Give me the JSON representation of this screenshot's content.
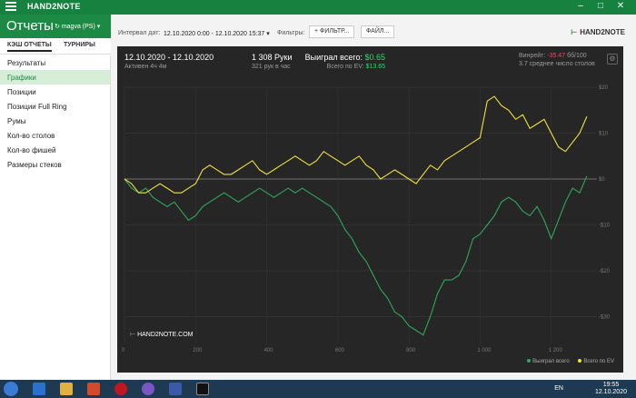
{
  "titlebar": {
    "app_name": "HAND2NOTE"
  },
  "header": {
    "title": "Отчеты",
    "profile": "magva (PS)"
  },
  "tabs": [
    {
      "label": "КЭШ ОТЧЕТЫ"
    },
    {
      "label": "ТУРНИРЫ"
    }
  ],
  "sidebar": {
    "items": [
      {
        "label": "Результаты"
      },
      {
        "label": "Графики"
      },
      {
        "label": "Позиции"
      },
      {
        "label": "Позиции Full Ring"
      },
      {
        "label": "Румы"
      },
      {
        "label": "Кол-во столов"
      },
      {
        "label": "Кол-во фишей"
      },
      {
        "label": "Размеры стеков"
      }
    ]
  },
  "toolbar": {
    "interval_label": "Интервал дат:",
    "interval_value": "12.10.2020 0:00 - 12.10.2020 15:37",
    "filters_label": "Фильтры:",
    "filter_button": "ФИЛЬТР...",
    "file_button": "ФАЙЛ...",
    "logo_text": "HAND2NOTE"
  },
  "stats": {
    "date_range": "12.10.2020 - 12.10.2020",
    "active_time": "Активен 4ч 4м",
    "hands": "1 308 Руки",
    "hands_per_hour": "321 рук в час",
    "won_label": "Выиграл всего:",
    "won_value": "$0.65",
    "ev_label": "Всего по EV:",
    "ev_value": "$13.65",
    "winrate_label": "Винрейт:",
    "winrate_value": "-35.47",
    "winrate_unit": "бб/100",
    "avg_tables": "3.7 среднее число столов"
  },
  "chart_logo": "HAND2NOTE.COM",
  "colors": {
    "green": "#2fa85a",
    "yellow": "#f0e040",
    "accent": "#1c8a45"
  },
  "chart_data": {
    "type": "line",
    "x_ticks": [
      "0",
      "200",
      "400",
      "600",
      "800",
      "1 000",
      "1 200"
    ],
    "y_ticks": [
      "$20",
      "$10",
      "$0",
      "-$10",
      "-$20",
      "-$30"
    ],
    "xlim": [
      0,
      1308
    ],
    "ylim": [
      -35,
      21
    ],
    "series": [
      {
        "name": "Выиграл всего",
        "color": "#2fa85a",
        "x": [
          0,
          20,
          40,
          60,
          80,
          100,
          120,
          140,
          160,
          180,
          200,
          220,
          240,
          260,
          280,
          300,
          320,
          340,
          360,
          380,
          400,
          420,
          440,
          460,
          480,
          500,
          520,
          540,
          560,
          580,
          600,
          620,
          640,
          660,
          680,
          700,
          720,
          740,
          760,
          780,
          800,
          820,
          840,
          860,
          880,
          900,
          920,
          940,
          960,
          980,
          1000,
          1020,
          1040,
          1060,
          1080,
          1100,
          1120,
          1140,
          1160,
          1180,
          1200,
          1220,
          1240,
          1260,
          1280,
          1300
        ],
        "y": [
          0,
          -2,
          -3,
          -2,
          -4,
          -5,
          -6,
          -5,
          -7,
          -9,
          -8,
          -6,
          -5,
          -4,
          -3,
          -4,
          -5,
          -4,
          -3,
          -2,
          -3,
          -4,
          -3,
          -2,
          -3,
          -2,
          -3,
          -4,
          -5,
          -6,
          -8,
          -11,
          -13,
          -16,
          -18,
          -21,
          -24,
          -26,
          -29,
          -30,
          -32,
          -33,
          -34,
          -30,
          -25,
          -22,
          -22,
          -21,
          -18,
          -13,
          -12,
          -10,
          -8,
          -5,
          -4,
          -5,
          -7,
          -8,
          -6,
          -9,
          -13,
          -9,
          -5,
          -2,
          -3,
          0.65
        ]
      },
      {
        "name": "Всего по EV",
        "color": "#f0e040",
        "x": [
          0,
          20,
          40,
          60,
          80,
          100,
          120,
          140,
          160,
          180,
          200,
          220,
          240,
          260,
          280,
          300,
          320,
          340,
          360,
          380,
          400,
          420,
          440,
          460,
          480,
          500,
          520,
          540,
          560,
          580,
          600,
          620,
          640,
          660,
          680,
          700,
          720,
          740,
          760,
          780,
          800,
          820,
          840,
          860,
          880,
          900,
          920,
          940,
          960,
          980,
          1000,
          1020,
          1040,
          1060,
          1080,
          1100,
          1120,
          1140,
          1160,
          1180,
          1200,
          1220,
          1240,
          1260,
          1280,
          1300
        ],
        "y": [
          0,
          -1,
          -3,
          -3,
          -2,
          -1,
          -2,
          -3,
          -3,
          -2,
          -1,
          2,
          3,
          2,
          1,
          1,
          2,
          3,
          4,
          2,
          1,
          2,
          3,
          4,
          5,
          4,
          3,
          4,
          6,
          5,
          4,
          3,
          4,
          5,
          3,
          2,
          0,
          1,
          2,
          1,
          0,
          -1,
          1,
          3,
          2,
          4,
          5,
          6,
          7,
          8,
          9,
          17,
          18,
          16,
          15,
          13,
          14,
          11,
          12,
          13,
          10,
          7,
          6,
          8,
          10,
          13.65
        ]
      }
    ],
    "legend": "bottom-right",
    "grid": true
  }
}
